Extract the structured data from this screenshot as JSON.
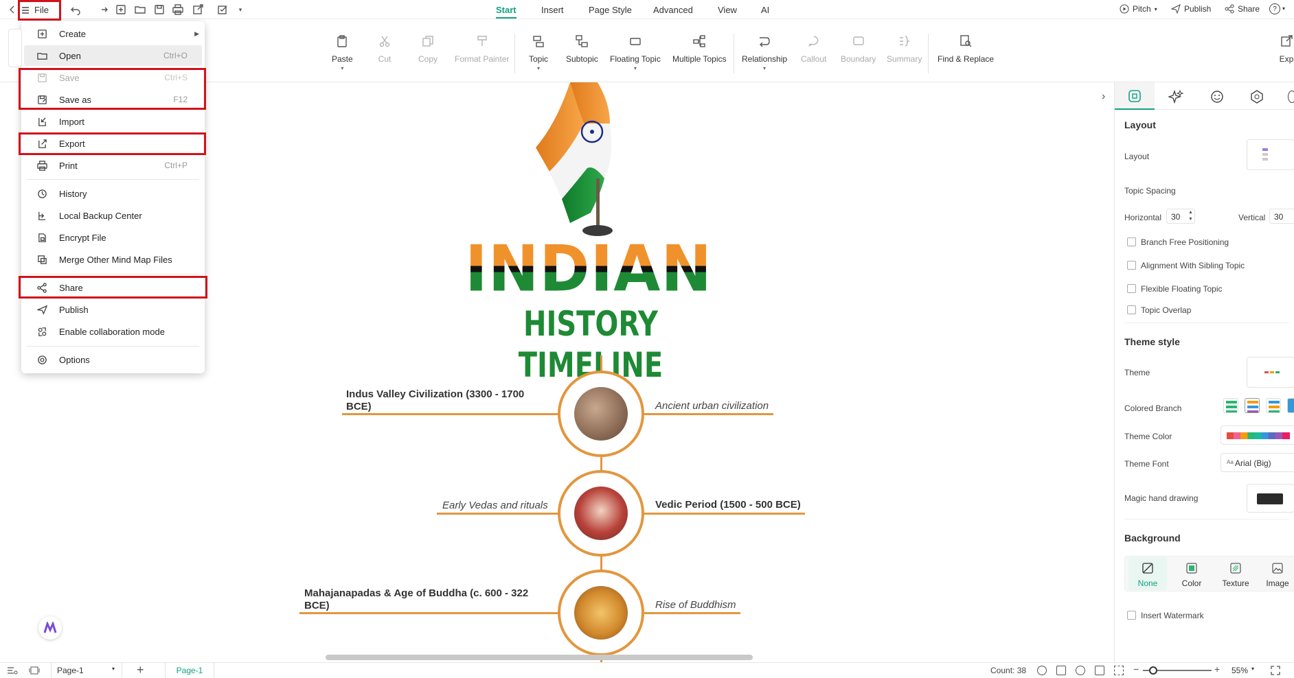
{
  "quickbar": {
    "file_label": "File",
    "icons": [
      "back-icon",
      "hamburger-icon",
      "undo-icon",
      "redo-icon",
      "new-icon",
      "open-folder-icon",
      "save-icon",
      "print-icon",
      "export-icon",
      "checklist-icon",
      "more-icon"
    ]
  },
  "menu_tabs": [
    "Start",
    "Insert",
    "Page Style",
    "Advanced",
    "View",
    "AI"
  ],
  "top_right": {
    "pitch": "Pitch",
    "publish": "Publish",
    "share": "Share",
    "help": "?"
  },
  "ribbon": [
    {
      "label": "Paste",
      "icon": "paste-icon"
    },
    {
      "label": "Cut",
      "icon": "cut-icon"
    },
    {
      "label": "Copy",
      "icon": "copy-icon"
    },
    {
      "label": "Format Painter",
      "icon": "format-painter-icon"
    },
    {
      "label": "Topic",
      "icon": "topic-icon"
    },
    {
      "label": "Subtopic",
      "icon": "subtopic-icon"
    },
    {
      "label": "Floating Topic",
      "icon": "floating-topic-icon"
    },
    {
      "label": "Multiple Topics",
      "icon": "multiple-topics-icon"
    },
    {
      "label": "Relationship",
      "icon": "relationship-icon"
    },
    {
      "label": "Callout",
      "icon": "callout-icon"
    },
    {
      "label": "Boundary",
      "icon": "boundary-icon"
    },
    {
      "label": "Summary",
      "icon": "summary-icon"
    },
    {
      "label": "Find & Replace",
      "icon": "find-replace-icon"
    },
    {
      "label": "Exp",
      "icon": "export-icon"
    }
  ],
  "file_menu": {
    "items": [
      {
        "label": "Create",
        "shortcut": "",
        "icon": "create-icon"
      },
      {
        "label": "Open",
        "shortcut": "Ctrl+O",
        "icon": "folder-icon"
      },
      {
        "label": "Save",
        "shortcut": "Ctrl+S",
        "icon": "save-icon"
      },
      {
        "label": "Save as",
        "shortcut": "F12",
        "icon": "save-as-icon"
      },
      {
        "label": "Import",
        "shortcut": "",
        "icon": "import-icon"
      },
      {
        "label": "Export",
        "shortcut": "",
        "icon": "export-icon"
      },
      {
        "label": "Print",
        "shortcut": "Ctrl+P",
        "icon": "print-icon"
      },
      {
        "label": "History",
        "shortcut": "",
        "icon": "history-icon"
      },
      {
        "label": "Local Backup Center",
        "shortcut": "",
        "icon": "backup-icon"
      },
      {
        "label": "Encrypt File",
        "shortcut": "",
        "icon": "encrypt-icon"
      },
      {
        "label": "Merge Other Mind Map Files",
        "shortcut": "",
        "icon": "merge-icon"
      },
      {
        "label": "Share",
        "shortcut": "",
        "icon": "share-icon"
      },
      {
        "label": "Publish",
        "shortcut": "",
        "icon": "publish-icon"
      },
      {
        "label": "Enable collaboration mode",
        "shortcut": "",
        "icon": "collaboration-icon"
      },
      {
        "label": "Options",
        "shortcut": "",
        "icon": "options-icon"
      }
    ]
  },
  "canvas": {
    "title_line1": "INDIAN",
    "title_line2": "HISTORY TIMELINE",
    "topics": [
      {
        "main": "Indus Valley Civilization (3300 - 1700 BCE)",
        "sub": "Ancient urban civilization"
      },
      {
        "main": "Vedic Period (1500 - 500 BCE)",
        "sub": "Early Vedas and rituals"
      },
      {
        "main": "Mahajanapadas & Age of Buddha (c. 600 - 322 BCE)",
        "sub": "Rise of Buddhism"
      }
    ]
  },
  "right_panel": {
    "section_layout": "Layout",
    "layout_label": "Layout",
    "topic_spacing": "Topic Spacing",
    "horizontal_label": "Horizontal",
    "horizontal_value": "30",
    "vertical_label": "Vertical",
    "vertical_value": "30",
    "checkboxes": [
      "Branch Free Positioning",
      "Alignment With Sibling Topic",
      "Flexible Floating Topic",
      "Topic Overlap"
    ],
    "section_theme": "Theme style",
    "theme_label": "Theme",
    "colored_branch": "Colored Branch",
    "theme_color": "Theme Color",
    "theme_font": "Theme Font",
    "theme_font_value": "Arial (Big)",
    "theme_font_prefix": "Aa",
    "magic_hand": "Magic hand drawing",
    "section_background": "Background",
    "bg_options": [
      "None",
      "Color",
      "Texture",
      "Image"
    ],
    "insert_watermark": "Insert Watermark"
  },
  "status": {
    "page_select": "Page-1",
    "page_tab": "Page-1",
    "count": "Count: 38",
    "zoom": "55%"
  },
  "colors": {
    "accent": "#10a37f",
    "branch": "#e3963e",
    "highlight": "#d0121b"
  }
}
